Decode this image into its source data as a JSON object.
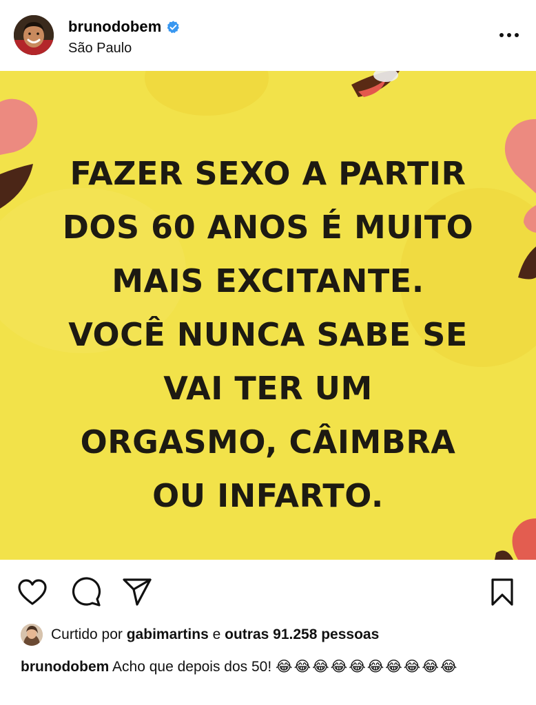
{
  "header": {
    "username": "brunodobem",
    "location": "São Paulo",
    "verified_color": "#3897f0"
  },
  "media": {
    "lines": [
      "FAZER SEXO A PARTIR",
      "DOS 60 ANOS É MUITO",
      "MAIS EXCITANTE.",
      "VOCÊ NUNCA SABE SE",
      "VAI TER UM",
      "ORGASMO, CÂIMBRA",
      "OU INFARTO."
    ],
    "background_color": "#f2e24a",
    "text_color": "#1d1a12"
  },
  "actions": {
    "icons": [
      "heart-icon",
      "comment-icon",
      "share-icon",
      "bookmark-icon"
    ]
  },
  "likes": {
    "prefix": "Curtido por",
    "user": "gabimartins",
    "conjunction": "e",
    "others": "outras 91.258 pessoas"
  },
  "caption": {
    "username": "brunodobem",
    "text": "Acho que depois dos 50!",
    "emojis": "😂😂😂😂😂😂😂😂😂😂"
  }
}
